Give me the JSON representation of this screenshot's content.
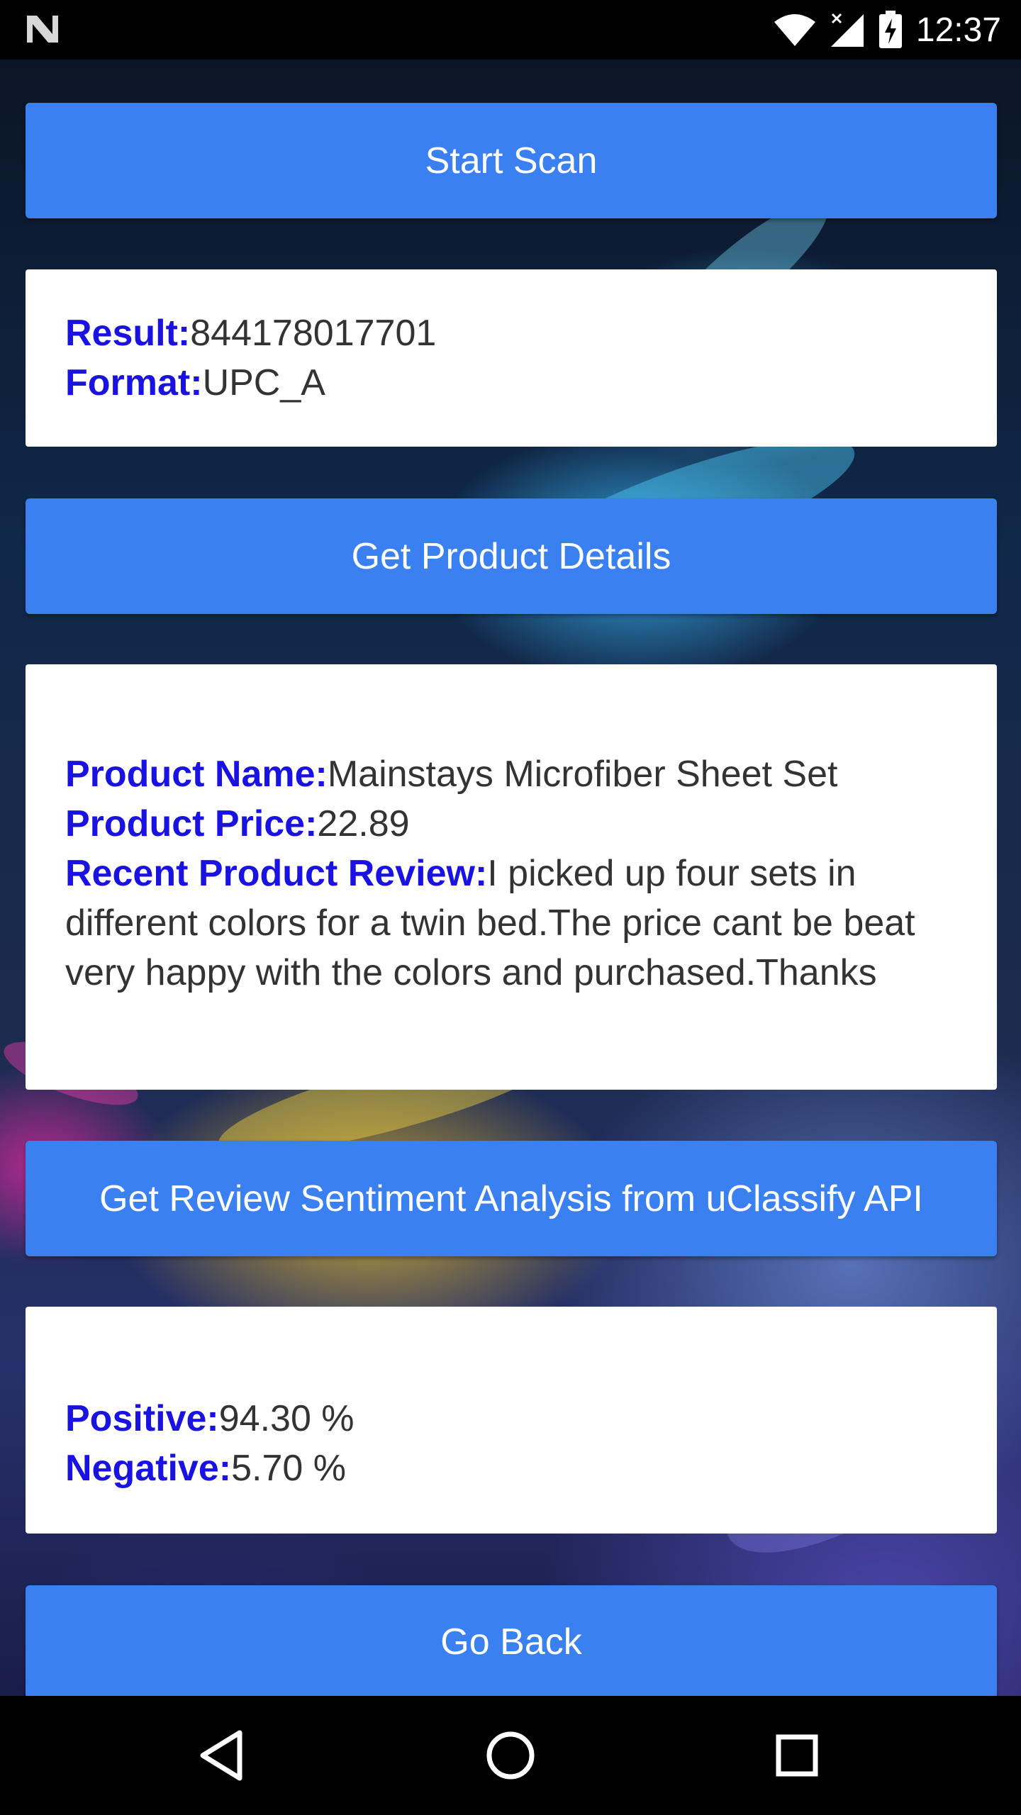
{
  "status_bar": {
    "time": "12:37",
    "icons": [
      "android-n-icon",
      "wifi-icon",
      "cell-signal-icon",
      "battery-charging-icon"
    ]
  },
  "buttons": {
    "start_scan": "Start Scan",
    "get_product_details": "Get Product Details",
    "get_sentiment": "Get Review Sentiment Analysis from uClassify API",
    "go_back": "Go Back"
  },
  "scan_result": {
    "result_label": "Result:",
    "result_value": "844178017701",
    "format_label": "Format:",
    "format_value": "UPC_A"
  },
  "product": {
    "name_label": "Product Name:",
    "name_value": "Mainstays Microfiber Sheet Set",
    "price_label": "Product Price:",
    "price_value": "22.89",
    "review_label": "Recent Product Review:",
    "review_value": "I picked up four sets in different colors for a twin bed.The price cant be beat very happy with the colors and purchased.Thanks"
  },
  "sentiment": {
    "positive_label": "Positive:",
    "positive_value": "94.30 %",
    "negative_label": "Negative:",
    "negative_value": "5.70 %"
  },
  "nav_bar": {
    "icons": [
      "back-icon",
      "home-icon",
      "recents-icon"
    ]
  },
  "colors": {
    "button": "#3b80f1",
    "label": "#1a12e0",
    "value_text": "#333333"
  }
}
